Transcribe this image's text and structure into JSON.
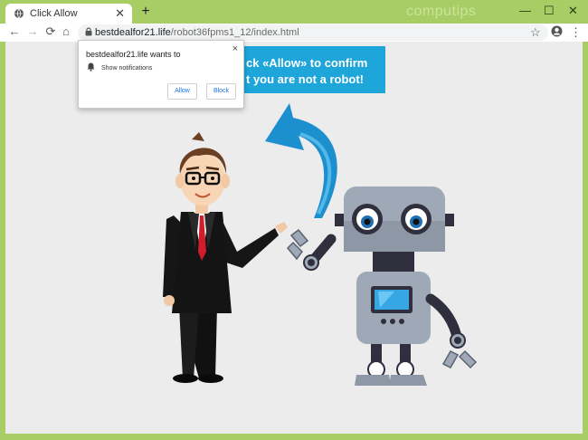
{
  "browser": {
    "tab": {
      "title": "Click Allow",
      "close": "✕"
    },
    "new_tab": "+",
    "watermark": "computips",
    "window": {
      "minimize": "—",
      "maximize": "☐",
      "close": "✕"
    },
    "nav": {
      "back": "←",
      "forward": "→",
      "reload": "⟳",
      "home": "⌂"
    },
    "url": {
      "host": "bestdealfor21.life",
      "path": "/robot36fpms1_12/index.html"
    },
    "menu": "⋮"
  },
  "banner": {
    "line1": "ck «Allow» to confirm",
    "line2": "t you are not a robot!",
    "color": "#1ea5da"
  },
  "permission_popup": {
    "title": "bestdealfor21.life wants to",
    "permission": "Show notifications",
    "allow_label": "Allow",
    "block_label": "Block",
    "close": "×"
  },
  "colors": {
    "frame": "#a8cd64",
    "page_bg": "#ececec",
    "arrow": "#1c8fcf",
    "robot_body": "#9ea8b7"
  }
}
